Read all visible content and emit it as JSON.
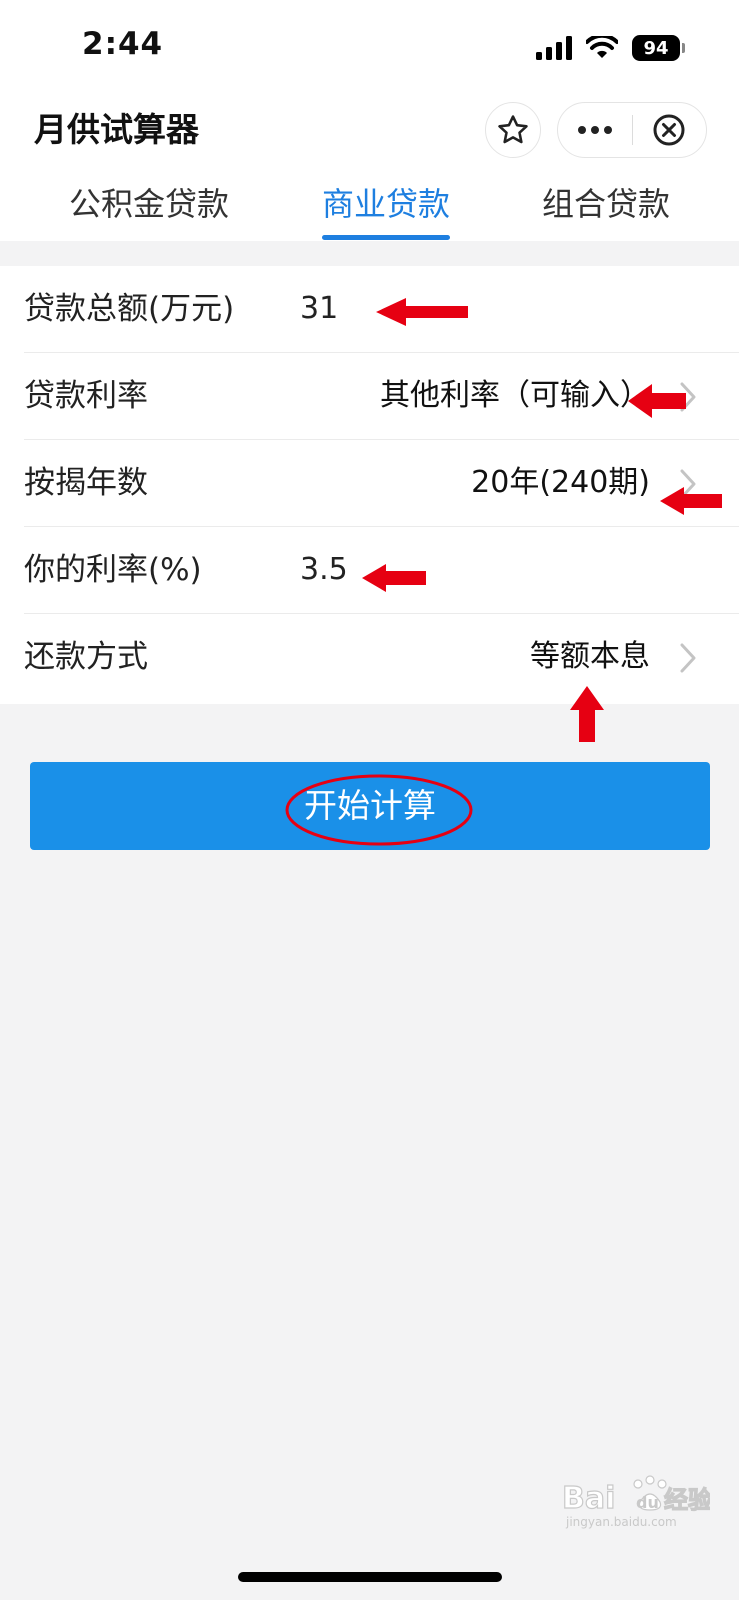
{
  "status_bar": {
    "time": "2:44",
    "battery": "94",
    "icons": [
      "signal-icon",
      "wifi-icon",
      "battery-icon"
    ]
  },
  "header": {
    "title": "月供试算器",
    "icons": [
      "star-icon",
      "more-icon",
      "close-icon"
    ]
  },
  "tabs": [
    {
      "label": "公积金贷款",
      "active": false
    },
    {
      "label": "商业贷款",
      "active": true
    },
    {
      "label": "组合贷款",
      "active": false
    }
  ],
  "form": {
    "loan_amount": {
      "label": "贷款总额(万元)",
      "value": "31"
    },
    "loan_rate": {
      "label": "贷款利率",
      "value": "其他利率（可输入）"
    },
    "loan_years": {
      "label": "按揭年数",
      "value": "20年(240期)"
    },
    "your_rate": {
      "label": "你的利率(%)",
      "value": "3.5"
    },
    "repay_method": {
      "label": "还款方式",
      "value": "等额本息"
    }
  },
  "start_button": {
    "label": "开始计算"
  },
  "watermark": {
    "brand": "Baidu经验",
    "url": "jingyan.baidu.com"
  },
  "colors": {
    "accent": "#1e7fe0",
    "button": "#1a90e8",
    "annotation": "#e60012",
    "background": "#f3f3f4"
  }
}
